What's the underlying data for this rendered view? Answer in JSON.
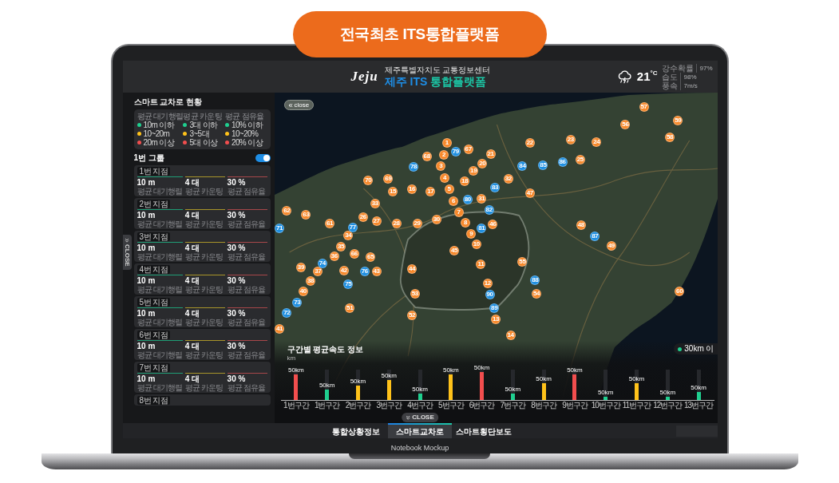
{
  "banner": {
    "text": "전국최초 ITS통합플랫폼"
  },
  "header": {
    "logo": "Jeju",
    "subtitle": "제주특별자치도 교통정보센터",
    "title": [
      "제주 ITS",
      "통합플랫폼"
    ],
    "weather": {
      "temperature": "21",
      "unit": "°C",
      "stats": [
        {
          "label": "강수확률",
          "value": "97%"
        },
        {
          "label": "습도",
          "value": "98%"
        },
        {
          "label": "풍속",
          "value": "7m/s"
        }
      ]
    }
  },
  "sidebar": {
    "title": "스마트 교차로 현황",
    "close_tab": "CLOSE",
    "legend": [
      {
        "heading": "평균 대기행렬",
        "items": [
          {
            "label": "10m 이하",
            "color": "#1fcf8f"
          },
          {
            "label": "10~20m",
            "color": "#ffc21a"
          },
          {
            "label": "20m 이상",
            "color": "#f24e4e"
          }
        ]
      },
      {
        "heading": "평균 카운팅",
        "items": [
          {
            "label": "3대 이하",
            "color": "#1fcf8f"
          },
          {
            "label": "3~5대",
            "color": "#ffc21a"
          },
          {
            "label": "5대 이상",
            "color": "#f24e4e"
          }
        ]
      },
      {
        "heading": "평균 점유율",
        "items": [
          {
            "label": "10% 이하",
            "color": "#1fcf8f"
          },
          {
            "label": "10~20%",
            "color": "#ffc21a"
          },
          {
            "label": "20% 이상",
            "color": "#f24e4e"
          }
        ]
      }
    ],
    "group": {
      "name": "1번 그룹",
      "on": true
    },
    "points": [
      {
        "label": "1번 지점",
        "metrics": [
          {
            "value": "10 m",
            "caption": "평균 대기행렬",
            "color": "#1f9e76"
          },
          {
            "value": "4 대",
            "caption": "평균 카운팅",
            "color": "#a8952a"
          },
          {
            "value": "30 %",
            "caption": "평균 점유율",
            "color": "#a8474a"
          }
        ]
      },
      {
        "label": "2번 지점",
        "metrics": [
          {
            "value": "10 m",
            "caption": "평균 대기행렬",
            "color": "#1f9e76"
          },
          {
            "value": "4 대",
            "caption": "평균 카운팅",
            "color": "#a8952a"
          },
          {
            "value": "30 %",
            "caption": "평균 점유율",
            "color": "#a8474a"
          }
        ]
      },
      {
        "label": "3번 지점",
        "metrics": [
          {
            "value": "10 m",
            "caption": "평균 대기행렬",
            "color": "#1f9e76"
          },
          {
            "value": "4 대",
            "caption": "평균 카운팅",
            "color": "#a8952a"
          },
          {
            "value": "30 %",
            "caption": "평균 점유율",
            "color": "#a8474a"
          }
        ]
      },
      {
        "label": "4번 지점",
        "metrics": [
          {
            "value": "10 m",
            "caption": "평균 대기행렬",
            "color": "#1f9e76"
          },
          {
            "value": "4 대",
            "caption": "평균 카운팅",
            "color": "#a8952a"
          },
          {
            "value": "30 %",
            "caption": "평균 점유율",
            "color": "#a8474a"
          }
        ]
      },
      {
        "label": "5번 지점",
        "metrics": [
          {
            "value": "10 m",
            "caption": "평균 대기행렬",
            "color": "#1f9e76"
          },
          {
            "value": "4 대",
            "caption": "평균 카운팅",
            "color": "#a8952a"
          },
          {
            "value": "30 %",
            "caption": "평균 점유율",
            "color": "#a8474a"
          }
        ]
      },
      {
        "label": "6번 지점",
        "metrics": [
          {
            "value": "10 m",
            "caption": "평균 대기행렬",
            "color": "#1f9e76"
          },
          {
            "value": "4 대",
            "caption": "평균 카운팅",
            "color": "#a8952a"
          },
          {
            "value": "30 %",
            "caption": "평균 점유율",
            "color": "#a8474a"
          }
        ]
      },
      {
        "label": "7번 지점",
        "metrics": [
          {
            "value": "10 m",
            "caption": "평균 대기행렬",
            "color": "#1f9e76"
          },
          {
            "value": "4 대",
            "caption": "평균 카운팅",
            "color": "#a8952a"
          },
          {
            "value": "30 %",
            "caption": "평균 점유율",
            "color": "#a8474a"
          }
        ]
      },
      {
        "label": "8번 지점"
      }
    ]
  },
  "map": {
    "close_button": "close",
    "legend": {
      "label": "30km 이",
      "color": "#1fcf8f"
    },
    "markers": [
      {
        "label": "1",
        "color": "#f7892b"
      },
      {
        "label": "2",
        "color": "#f7892b"
      },
      {
        "label": "3",
        "color": "#f7892b"
      },
      {
        "label": "4",
        "color": "#f7892b"
      },
      {
        "label": "5",
        "color": "#f7892b"
      },
      {
        "label": "6",
        "color": "#f7892b"
      },
      {
        "label": "7",
        "color": "#f7892b"
      },
      {
        "label": "8",
        "color": "#f7892b"
      },
      {
        "label": "9",
        "color": "#f7892b"
      },
      {
        "label": "10",
        "color": "#f7892b"
      },
      {
        "label": "11",
        "color": "#f7892b"
      },
      {
        "label": "12",
        "color": "#f7892b"
      },
      {
        "label": "13",
        "color": "#f7892b"
      },
      {
        "label": "14",
        "color": "#f7892b"
      },
      {
        "label": "15",
        "color": "#f7892b"
      },
      {
        "label": "16",
        "color": "#f7892b"
      },
      {
        "label": "17",
        "color": "#f7892b"
      },
      {
        "label": "18",
        "color": "#f7892b"
      },
      {
        "label": "19",
        "color": "#f7892b"
      },
      {
        "label": "20",
        "color": "#f7892b"
      },
      {
        "label": "21",
        "color": "#f7892b"
      },
      {
        "label": "22",
        "color": "#f7892b"
      },
      {
        "label": "23",
        "color": "#f7892b"
      },
      {
        "label": "24",
        "color": "#f7892b"
      },
      {
        "label": "25",
        "color": "#f7892b"
      },
      {
        "label": "26",
        "color": "#f7892b"
      },
      {
        "label": "27",
        "color": "#f7892b"
      },
      {
        "label": "28",
        "color": "#f7892b"
      },
      {
        "label": "29",
        "color": "#f7892b"
      },
      {
        "label": "30",
        "color": "#f7892b"
      },
      {
        "label": "31",
        "color": "#f7892b"
      },
      {
        "label": "32",
        "color": "#f7892b"
      },
      {
        "label": "33",
        "color": "#f7892b"
      },
      {
        "label": "34",
        "color": "#f7892b"
      },
      {
        "label": "35",
        "color": "#f7892b"
      },
      {
        "label": "36",
        "color": "#f7892b"
      },
      {
        "label": "37",
        "color": "#f7892b"
      },
      {
        "label": "38",
        "color": "#f7892b"
      },
      {
        "label": "39",
        "color": "#f7892b"
      },
      {
        "label": "40",
        "color": "#f7892b"
      },
      {
        "label": "41",
        "color": "#f7892b"
      },
      {
        "label": "42",
        "color": "#f7892b"
      },
      {
        "label": "43",
        "color": "#f7892b"
      },
      {
        "label": "44",
        "color": "#f7892b"
      },
      {
        "label": "45",
        "color": "#f7892b"
      },
      {
        "label": "46",
        "color": "#f7892b"
      },
      {
        "label": "47",
        "color": "#f7892b"
      },
      {
        "label": "48",
        "color": "#f7892b"
      },
      {
        "label": "49",
        "color": "#f7892b"
      },
      {
        "label": "51",
        "color": "#f7892b"
      },
      {
        "label": "52",
        "color": "#f7892b"
      },
      {
        "label": "53",
        "color": "#f7892b"
      },
      {
        "label": "54",
        "color": "#f7892b"
      },
      {
        "label": "55",
        "color": "#f7892b"
      },
      {
        "label": "56",
        "color": "#f7892b"
      },
      {
        "label": "57",
        "color": "#f7892b"
      },
      {
        "label": "58",
        "color": "#f7892b"
      },
      {
        "label": "59",
        "color": "#f7892b"
      },
      {
        "label": "60",
        "color": "#f7892b"
      },
      {
        "label": "61",
        "color": "#f7892b"
      },
      {
        "label": "62",
        "color": "#f7892b"
      },
      {
        "label": "63",
        "color": "#f7892b"
      },
      {
        "label": "65",
        "color": "#f7892b"
      },
      {
        "label": "66",
        "color": "#f7892b"
      },
      {
        "label": "67",
        "color": "#f7892b"
      },
      {
        "label": "68",
        "color": "#f7892b"
      },
      {
        "label": "69",
        "color": "#f7892b"
      },
      {
        "label": "70",
        "color": "#f7892b"
      },
      {
        "label": "71",
        "color": "#1e8fe1"
      },
      {
        "label": "72",
        "color": "#1e8fe1"
      },
      {
        "label": "73",
        "color": "#1e8fe1"
      },
      {
        "label": "74",
        "color": "#1e8fe1"
      },
      {
        "label": "75",
        "color": "#1e8fe1"
      },
      {
        "label": "76",
        "color": "#1e8fe1"
      },
      {
        "label": "77",
        "color": "#1e8fe1"
      },
      {
        "label": "78",
        "color": "#1e8fe1"
      },
      {
        "label": "79",
        "color": "#1e8fe1"
      },
      {
        "label": "80",
        "color": "#1e8fe1"
      },
      {
        "label": "81",
        "color": "#1e8fe1"
      },
      {
        "label": "82",
        "color": "#1e8fe1"
      },
      {
        "label": "83",
        "color": "#1e8fe1"
      },
      {
        "label": "84",
        "color": "#1e8fe1"
      },
      {
        "label": "85",
        "color": "#1e8fe1"
      },
      {
        "label": "86",
        "color": "#1e8fe1"
      },
      {
        "label": "87",
        "color": "#1e8fe1"
      },
      {
        "label": "88",
        "color": "#1e8fe1"
      },
      {
        "label": "89",
        "color": "#1e8fe1"
      },
      {
        "label": "90",
        "color": "#1e8fe1"
      }
    ]
  },
  "speed_chart": {
    "title": "구간별 평균속도 정보",
    "unit": "km",
    "close_button": "CLOSE",
    "sections": [
      {
        "label": "1번구간",
        "reading": "50km",
        "level": 0.85,
        "color": "#f24e4e"
      },
      {
        "label": "1번구간",
        "reading": "50km",
        "level": 0.33,
        "color": "#1fcf8f"
      },
      {
        "label": "2번구간",
        "reading": "50km",
        "level": 0.47,
        "color": "#ffc21a"
      },
      {
        "label": "3번구간",
        "reading": "50km",
        "level": 0.65,
        "color": "#ffc21a"
      },
      {
        "label": "4번구간",
        "reading": "50km",
        "level": 0.2,
        "color": "#1fcf8f"
      },
      {
        "label": "5번구간",
        "reading": "50km",
        "level": 0.85,
        "color": "#ffc21a"
      },
      {
        "label": "6번구간",
        "reading": "50km",
        "level": 0.93,
        "color": "#f24e4e"
      },
      {
        "label": "7번구간",
        "reading": "50km",
        "level": 0.2,
        "color": "#1fcf8f"
      },
      {
        "label": "8번구간",
        "reading": "50km",
        "level": 0.55,
        "color": "#ffc21a"
      },
      {
        "label": "9번구간",
        "reading": "50km",
        "level": 0.85,
        "color": "#f24e4e"
      },
      {
        "label": "10번구간",
        "reading": "50km",
        "level": 0.1,
        "color": "#1fcf8f"
      },
      {
        "label": "11번구간",
        "reading": "50km",
        "level": 0.55,
        "color": "#ffc21a"
      },
      {
        "label": "12번구간",
        "reading": "50km",
        "level": 0.1,
        "color": "#1fcf8f"
      },
      {
        "label": "13번구간",
        "reading": "50km",
        "level": 0.26,
        "color": "#1fcf8f"
      }
    ]
  },
  "tabs": [
    {
      "label": "통합상황정보",
      "selected": false
    },
    {
      "label": "스마트교차로",
      "selected": true
    },
    {
      "label": "스마트횡단보도",
      "selected": false
    }
  ],
  "device": {
    "label": "Notebook Mockup"
  }
}
